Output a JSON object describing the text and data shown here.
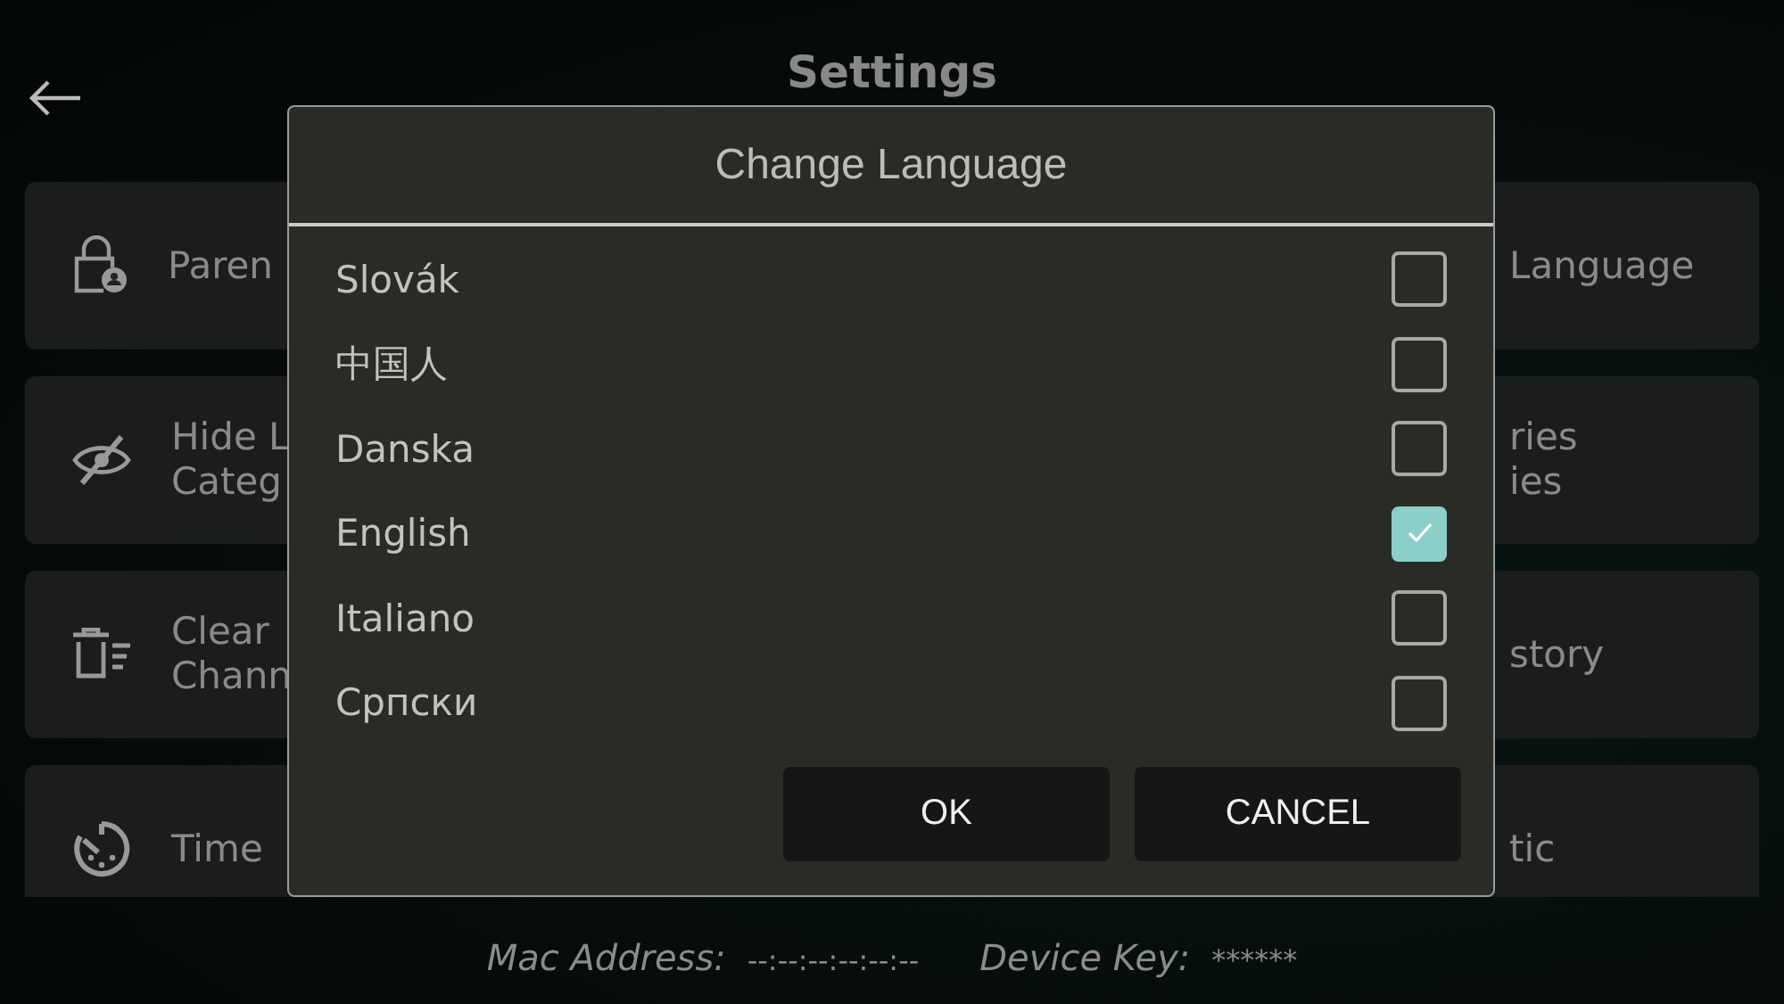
{
  "header": {
    "title": "Settings"
  },
  "settings_cards": [
    {
      "kind": "lock",
      "lines": [
        "Paren"
      ]
    },
    {
      "lines": [
        "Language"
      ]
    },
    {
      "kind": "eye-off",
      "lines": [
        "Hide L",
        "Categ"
      ]
    },
    {
      "lines": [
        "ries",
        "ies"
      ]
    },
    {
      "kind": "trash",
      "lines": [
        "Clear",
        "Chann"
      ]
    },
    {
      "lines": [
        "story"
      ]
    },
    {
      "kind": "timer",
      "lines": [
        "Time"
      ]
    },
    {
      "lines": [
        "tic"
      ]
    }
  ],
  "dialog": {
    "title": "Change Language",
    "languages": [
      {
        "label": "Slovák",
        "selected": false
      },
      {
        "label": "中国人",
        "selected": false
      },
      {
        "label": "Danska",
        "selected": false
      },
      {
        "label": "English",
        "selected": true
      },
      {
        "label": "Italiano",
        "selected": false
      },
      {
        "label": "Српски",
        "selected": false
      }
    ],
    "buttons": [
      "OK",
      "CANCEL"
    ]
  },
  "footer": {
    "mac_label": "Mac Address:",
    "mac_value": "--:--:--:--:--:--",
    "key_label": "Device Key:",
    "key_value": "******"
  }
}
